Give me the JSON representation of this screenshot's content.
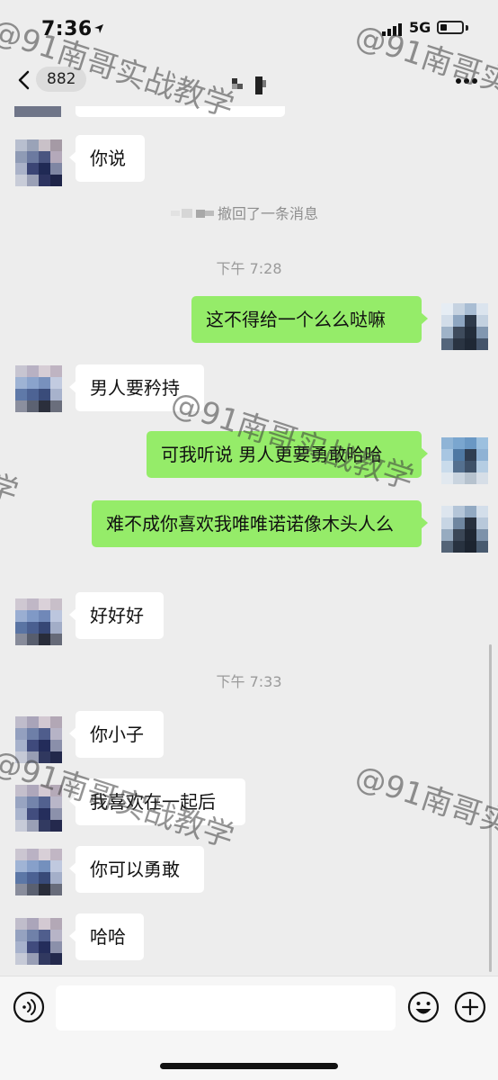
{
  "status_bar": {
    "time": "7:36",
    "network": "5G"
  },
  "nav": {
    "unread_count": "882"
  },
  "colors": {
    "incoming_bubble": "#ffffff",
    "outgoing_bubble": "#95ec69",
    "background": "#ededed"
  },
  "icons": {
    "back": "chevron-left-icon",
    "more": "more-dots-icon",
    "voice": "voice-icon",
    "emoji": "emoji-icon",
    "plus": "plus-icon"
  },
  "chat": {
    "messages": [
      {
        "from": "them",
        "text": "你说"
      },
      {
        "system": "撤回了一条消息"
      },
      {
        "timestamp": "下午 7:28"
      },
      {
        "from": "me",
        "text": "这不得给一个么么哒嘛"
      },
      {
        "from": "them",
        "text": "男人要矜持"
      },
      {
        "from": "me",
        "text": "可我听说 男人更要勇敢哈哈"
      },
      {
        "from": "me",
        "text": "难不成你喜欢我唯唯诺诺像木头人么"
      },
      {
        "from": "them",
        "text": "好好好"
      },
      {
        "timestamp": "下午 7:33"
      },
      {
        "from": "them",
        "text": "你小子"
      },
      {
        "from": "them",
        "text": "我喜欢在一起后"
      },
      {
        "from": "them",
        "text": "你可以勇敢"
      },
      {
        "from": "them",
        "text": "哈哈"
      }
    ]
  },
  "watermark": "@91南哥实战教学"
}
